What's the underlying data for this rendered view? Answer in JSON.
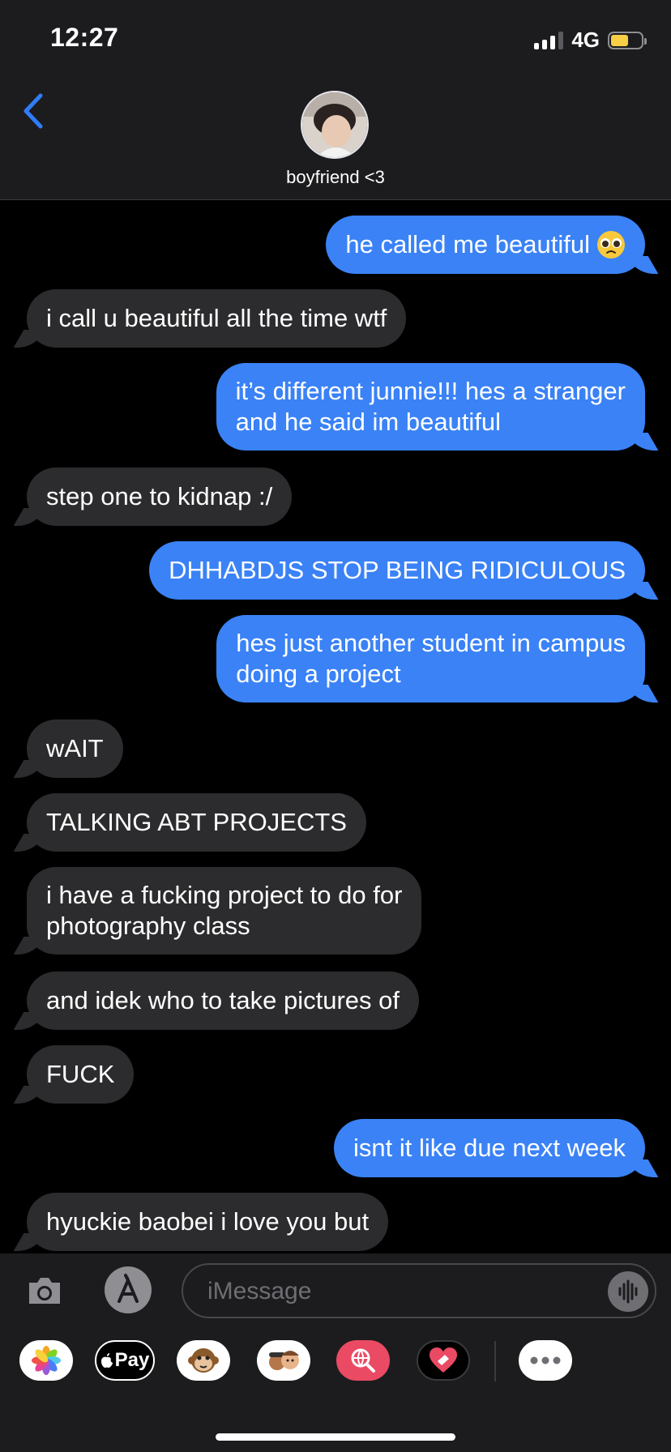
{
  "status_bar": {
    "time": "12:27",
    "network": "4G",
    "battery_percent": 58
  },
  "header": {
    "contact_name": "boyfriend <3",
    "back_icon": "chevron-left-icon"
  },
  "colors": {
    "sent": "#3a82f6",
    "received": "#2c2c2e",
    "accent": "#2f7cf6",
    "background": "#000000"
  },
  "messages": [
    {
      "from": "me",
      "text": "he called me beautiful",
      "emoji": "pleading-face"
    },
    {
      "from": "them",
      "text": "i call u beautiful all the time wtf"
    },
    {
      "from": "me",
      "text": "it’s different junnie!!! hes a stranger\nand he said im beautiful"
    },
    {
      "from": "them",
      "text": "step one to kidnap :/"
    },
    {
      "from": "me",
      "text": "DHHABDJS STOP BEING RIDICULOUS"
    },
    {
      "from": "me",
      "text": "hes just another student in campus\ndoing a project"
    },
    {
      "from": "them",
      "text": "wAIT"
    },
    {
      "from": "them",
      "text": "TALKING ABT PROJECTS"
    },
    {
      "from": "them",
      "text": "i have a fucking project to do for\nphotography class"
    },
    {
      "from": "them",
      "text": "and idek who to take pictures of"
    },
    {
      "from": "them",
      "text": "FUCK"
    },
    {
      "from": "me",
      "text": "isnt it like due next week"
    },
    {
      "from": "them",
      "text": "hyuckie baobei i love you but"
    }
  ],
  "input": {
    "placeholder": "iMessage"
  },
  "app_drawer": {
    "apps": [
      "photos-icon",
      "apple-pay-icon",
      "animoji-monkey-icon",
      "memoji-icon",
      "image-search-icon",
      "digital-touch-icon",
      "more-icon"
    ],
    "apple_pay_label": "Pay"
  }
}
